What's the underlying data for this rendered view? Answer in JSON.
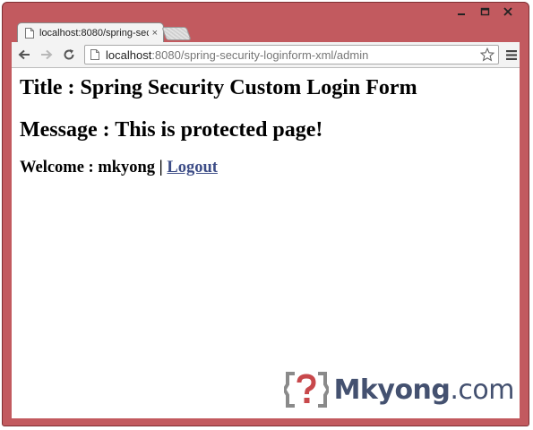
{
  "window": {
    "controls": [
      "minimize-icon",
      "maximize-icon",
      "close-icon"
    ]
  },
  "tab": {
    "title": "localhost:8080/spring-sec",
    "close_glyph": "×"
  },
  "omnibox": {
    "url_host": "localhost",
    "url_path": ":8080/spring-security-loginform-xml/admin"
  },
  "page": {
    "title_line": "Title : Spring Security Custom Login Form",
    "message_line": "Message : This is protected page!",
    "welcome_prefix": "Welcome : mkyong | ",
    "logout_label": "Logout"
  },
  "brand": {
    "name": "Mkyong",
    "suffix": ".com"
  },
  "colors": {
    "window_frame": "#c25a5f",
    "link": "#3d4d87",
    "brand_text": "#445170",
    "brand_logo_bracket": "#8a8a8a",
    "brand_logo_question": "#c8484b"
  }
}
